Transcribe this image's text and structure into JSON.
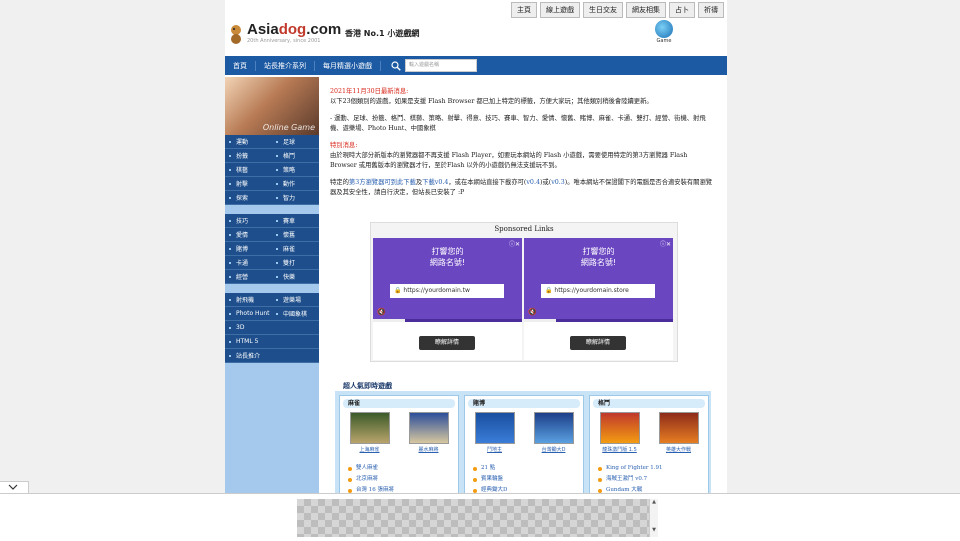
{
  "topnav": [
    "主頁",
    "線上遊戲",
    "生日交友",
    "網友相集",
    "占卜",
    "祈禱"
  ],
  "header": {
    "logo_main_pre": "Asia",
    "logo_main_dog": "dog",
    "logo_main_post": ".com",
    "logo_sub": "20th Anniversary, since 2001",
    "tagline": "香港 No.1 小遊戲網",
    "game_label": "Game"
  },
  "navbar": {
    "items": [
      "首頁",
      "站長推介系列",
      "每月精選小遊戲"
    ],
    "search_placeholder": "輸入遊戲名稱"
  },
  "sidebar": {
    "photo_caption": "Online Game",
    "group1": [
      [
        "運動",
        "足球"
      ],
      [
        "扮籤",
        "格鬥"
      ],
      [
        "棋藝",
        "策略"
      ],
      [
        "射擊",
        "動作"
      ],
      [
        "探索",
        "智力"
      ]
    ],
    "group2": [
      [
        "技巧",
        "賽車"
      ],
      [
        "愛情",
        "懷舊"
      ],
      [
        "賭博",
        "麻雀"
      ],
      [
        "卡通",
        "雙打"
      ],
      [
        "經營",
        "快樂"
      ]
    ],
    "group3": [
      [
        "射飛機",
        "遊樂場"
      ],
      [
        "Photo Hunt",
        "中國象棋"
      ],
      [
        "3D",
        ""
      ],
      [
        "HTML 5",
        ""
      ],
      [
        "站長推介",
        ""
      ]
    ]
  },
  "content": {
    "news_title": "2021年11月30日最新消息:",
    "news_body1": "以下23個類別的遊戲，如果是支援 Flash Browser 都已加上特定的標籤，方便大家玩；其他類別稍後會陸續更新。",
    "news_body2": "- 運動、足球、扮籤、格鬥、棋藝、策略、射擊、得意、技巧、賽車、智力、愛情、懷舊、賭博、麻雀、卡通、雙打、經營、街機、射飛機、遊樂場、Photo Hunt、中國象棋",
    "notice_title": "特別消息:",
    "notice_body": "由於現時大部分新版本的瀏覽器都不再支援 Flash Player，如要玩本網站的 Flash 小遊戲，需要使用特定的第3方瀏覽器 Flash Browser 或用舊版本的瀏覽器才行，至於Flash 以外的小遊戲仍無法支援玩不到。",
    "browser_pre": "特定的",
    "browser_link": "第3方瀏覽器可到此下載",
    "browser_mid": "及",
    "browser_link2": "下載",
    "browser_v1": "v0.4",
    "browser_mid2": "，或在本網站直接下載亦可",
    "browser_v2": "v0.4",
    "browser_or": "或",
    "browser_v3": "v0.3",
    "browser_post": "。唯本網站不保證閣下的電腦是否合適安裝有關瀏覽器及其安全性，請自行決定，但站長已安裝了 :P"
  },
  "ads": {
    "title": "Sponsored Links",
    "items": [
      {
        "headline1": "打響您的",
        "headline2": "網路名號!",
        "url_proto": "https://",
        "url_rest": "yourdomain.tw",
        "button": "瞭解詳情"
      },
      {
        "headline1": "打響您的",
        "headline2": "網路名號!",
        "url_proto": "https://",
        "url_rest": "yourdomain.store",
        "button": "瞭解詳情"
      }
    ]
  },
  "popular": {
    "title": "超人氣即時遊戲",
    "categories": [
      {
        "name": "麻雀",
        "thumbs": [
          "上海麻雀",
          "麗水麻將"
        ],
        "list": [
          "雙人麻雀",
          "北京麻將",
          "台灣 16 張麻將"
        ]
      },
      {
        "name": "賭博",
        "thumbs": [
          "鬥地主",
          "台灣鋤大D"
        ],
        "list": [
          "21 點",
          "賓果輪盤",
          "經典鋤大D"
        ]
      },
      {
        "name": "格鬥",
        "thumbs": [
          "龍珠激鬥版 1.5",
          "英雄大作戰"
        ],
        "list": [
          "King of Fighter 1.91",
          "海賊王激鬥 v0.7",
          "Gundam 大戰"
        ]
      }
    ]
  },
  "colors": {
    "nav_blue": "#1c5aa3",
    "sidebar_blue": "#1e4f8c",
    "ad_purple": "#6b46c1",
    "news_red": "#d8281c",
    "link_blue": "#2a60b0"
  }
}
